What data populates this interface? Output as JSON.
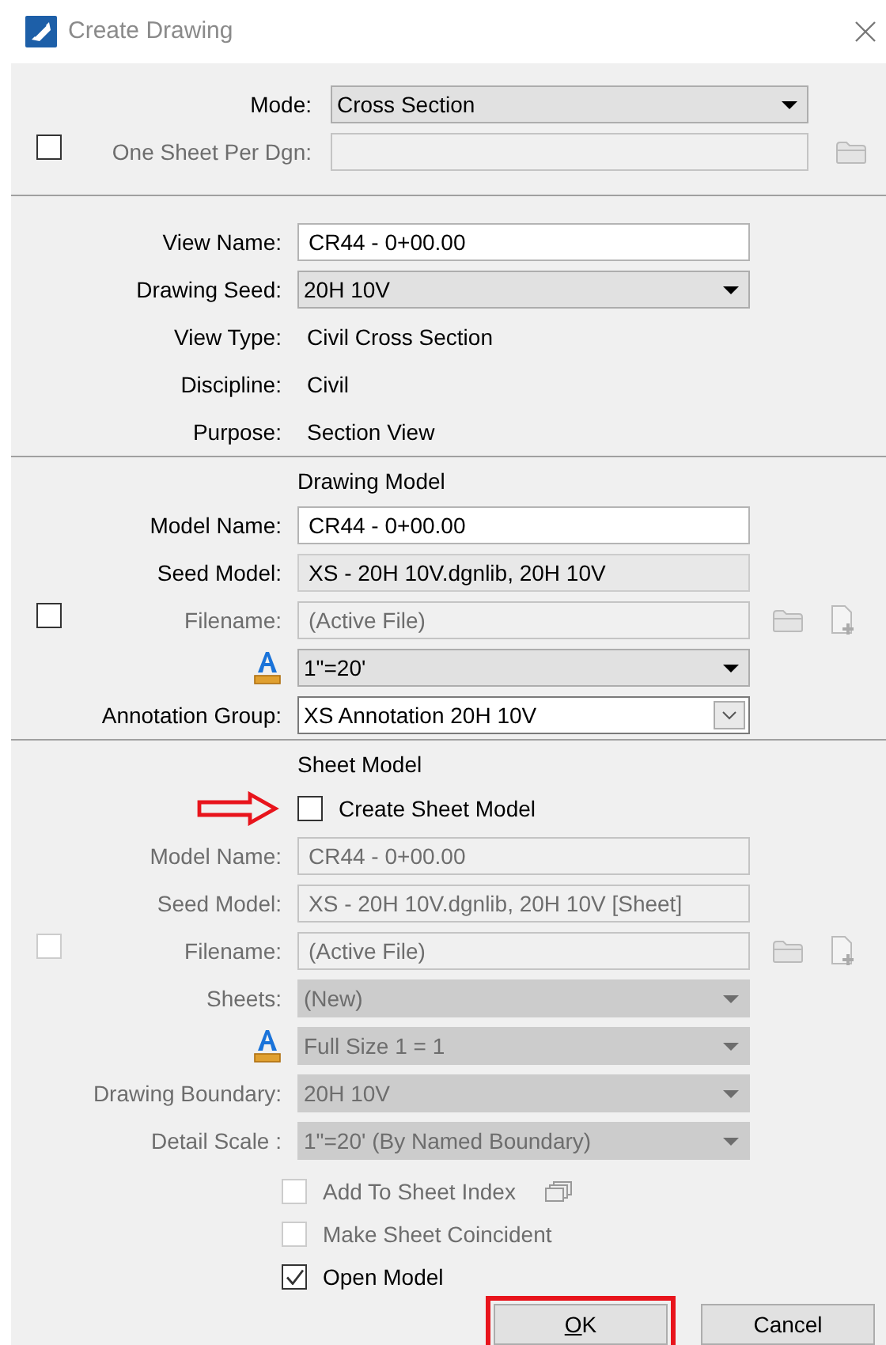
{
  "window": {
    "title": "Create Drawing"
  },
  "sections": [
    {
      "rows": [
        {
          "kind": "dropdown",
          "label": "Mode:",
          "value": "Cross Section",
          "disabled": false
        },
        {
          "kind": "input",
          "label": "One Sheet Per Dgn:",
          "value": "",
          "disabled": true,
          "toggle": {
            "checked": false,
            "disabled": false
          },
          "browse": true
        }
      ]
    },
    {
      "rows": [
        {
          "kind": "input",
          "label": "View Name:",
          "value": "CR44 - 0+00.00",
          "disabled": false
        },
        {
          "kind": "dropdown",
          "label": "Drawing Seed:",
          "value": "20H 10V",
          "disabled": false
        },
        {
          "kind": "text",
          "label": "View Type:",
          "value": "Civil Cross Section",
          "disabled": false
        },
        {
          "kind": "text",
          "label": "Discipline:",
          "value": "Civil",
          "disabled": false
        },
        {
          "kind": "text",
          "label": "Purpose:",
          "value": "Section View",
          "disabled": false
        }
      ]
    },
    {
      "heading": "Drawing Model",
      "rows": [
        {
          "kind": "input",
          "label": "Model Name:",
          "value": "CR44 - 0+00.00",
          "disabled": false
        },
        {
          "kind": "readonly",
          "label": "Seed Model:",
          "value": "XS - 20H 10V.dgnlib, 20H 10V",
          "disabled": false
        },
        {
          "kind": "input",
          "label": "Filename:",
          "value": "(Active File)",
          "disabled": true,
          "toggle": {
            "checked": false,
            "disabled": false
          },
          "browse": true,
          "new_file": true
        },
        {
          "kind": "dropdown",
          "scale_icon": true,
          "value": "1\"=20'",
          "disabled": false
        },
        {
          "kind": "combo",
          "label": "Annotation Group:",
          "value": "XS Annotation 20H 10V",
          "disabled": false
        }
      ]
    },
    {
      "heading": "Sheet Model",
      "rows": [
        {
          "kind": "check",
          "label": "Create Sheet Model",
          "checked": false,
          "disabled": false,
          "arrow": true
        },
        {
          "kind": "input",
          "label": "Model Name:",
          "value": "CR44 - 0+00.00",
          "disabled": true
        },
        {
          "kind": "input",
          "label": "Seed Model:",
          "value": "XS - 20H 10V.dgnlib, 20H 10V [Sheet]",
          "disabled": true
        },
        {
          "kind": "input",
          "label": "Filename:",
          "value": "(Active File)",
          "disabled": true,
          "toggle": {
            "checked": false,
            "disabled": true
          },
          "browse": true,
          "new_file": true
        },
        {
          "kind": "dropdown",
          "label": "Sheets:",
          "value": "(New)",
          "disabled": true
        },
        {
          "kind": "dropdown",
          "scale_icon": true,
          "value": "Full Size 1 = 1",
          "disabled": true
        },
        {
          "kind": "dropdown",
          "label": "Drawing Boundary:",
          "value": "20H 10V",
          "disabled": true
        },
        {
          "kind": "dropdown",
          "label": "Detail Scale :",
          "value": "1\"=20' (By Named Boundary)",
          "disabled": true
        }
      ]
    }
  ],
  "options": [
    {
      "label": "Add To Sheet Index",
      "checked": false,
      "disabled": true,
      "index_icon": true
    },
    {
      "label": "Make Sheet Coincident",
      "checked": false,
      "disabled": true
    },
    {
      "label": "Open Model",
      "checked": true,
      "disabled": false
    }
  ],
  "buttons": [
    {
      "label": "OK",
      "highlighted": true,
      "mnemonic": true
    },
    {
      "label": "Cancel",
      "highlighted": false
    }
  ]
}
